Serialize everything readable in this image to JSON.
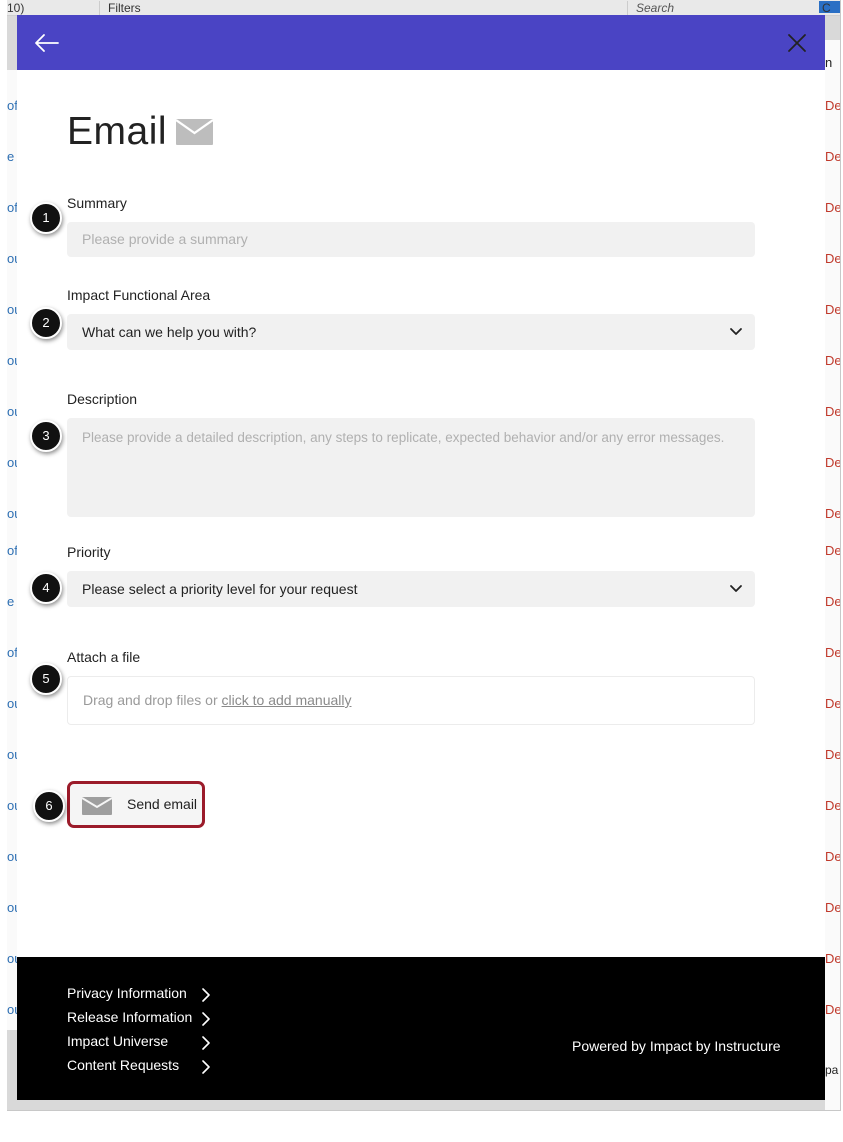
{
  "background": {
    "top_bar": {
      "select_value": "10)",
      "filters_label": "Filters",
      "search_placeholder": "Search",
      "button_label": "C"
    },
    "left_fragments": [
      "of",
      "e l",
      "of",
      "ou",
      "ou",
      "ou",
      "ou",
      "ou",
      "ou",
      "of",
      "e l",
      "of",
      "ou",
      "ou",
      "ou",
      "ou",
      "ou",
      "ou",
      "ou"
    ],
    "right_fragments": [
      "n",
      "De",
      "De",
      "De",
      "De",
      "De",
      "De",
      "De",
      "De",
      "De",
      "De",
      "De",
      "De",
      "De",
      "De",
      "De",
      "De",
      "De",
      "De",
      "De",
      "De",
      "pa"
    ]
  },
  "modal": {
    "header": {
      "color": "#4a44c4",
      "back_icon": "arrow-left-icon",
      "close_icon": "close-icon"
    },
    "title": "Email",
    "title_icon": "envelope-icon",
    "fields": {
      "summary": {
        "label": "Summary",
        "placeholder": "Please provide a summary",
        "callout": "1"
      },
      "impact_area": {
        "label": "Impact Functional Area",
        "value": "What can we help you with?",
        "callout": "2"
      },
      "description": {
        "label": "Description",
        "placeholder": "Please provide a detailed description, any steps to replicate, expected behavior and/or any error messages.",
        "callout": "3"
      },
      "priority": {
        "label": "Priority",
        "value": "Please select a priority level for your request",
        "callout": "4"
      },
      "attachment": {
        "label": "Attach a file",
        "prompt": "Drag and drop files or",
        "link": "click to add manually",
        "callout": "5"
      }
    },
    "send_button": {
      "label": "Send email",
      "icon": "envelope-icon",
      "callout": "6",
      "highlight_color": "#9b1b2a"
    },
    "footer": {
      "links": [
        "Privacy Information",
        "Release Information",
        "Impact Universe",
        "Content Requests"
      ],
      "powered_by": "Powered by Impact by Instructure"
    }
  }
}
